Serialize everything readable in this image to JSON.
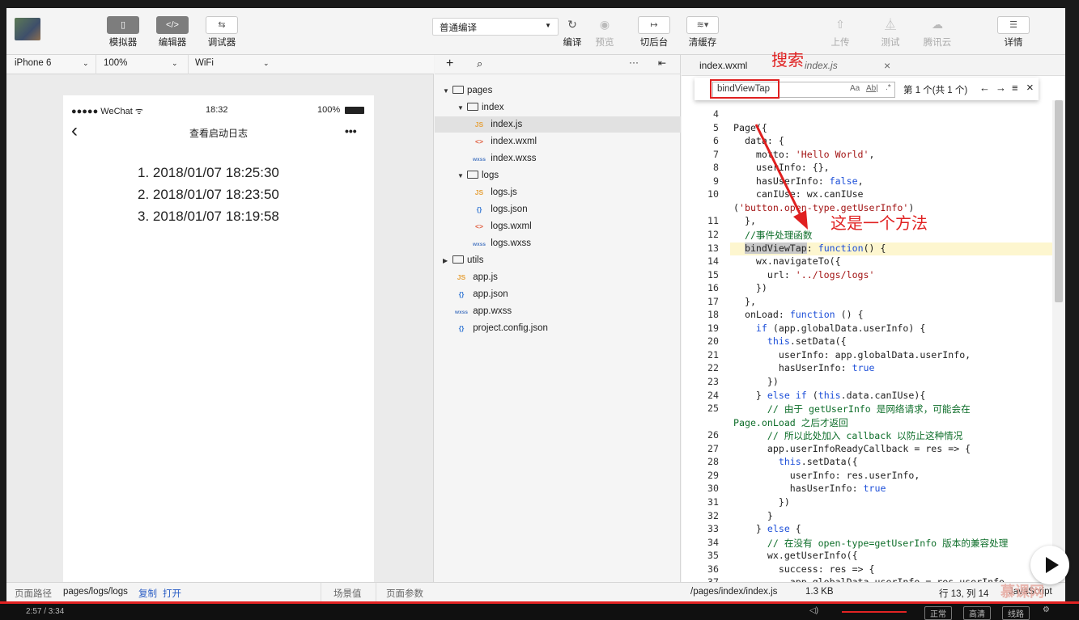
{
  "toolbar": {
    "simulator": "模拟器",
    "editor": "编辑器",
    "debugger": "调试器",
    "compile_mode": "普通编译",
    "compile": "编译",
    "preview": "预览",
    "background": "切后台",
    "clear_cache": "清缓存",
    "upload": "上传",
    "test": "测试",
    "tencent_cloud": "腾讯云",
    "details": "详情"
  },
  "simulator": {
    "device": "iPhone 6",
    "zoom": "100%",
    "network": "WiFi",
    "status_signal": "●●●●● WeChat ᯤ",
    "status_time": "18:32",
    "status_battery": "100%",
    "nav_title": "查看启动日志",
    "nav_back": "‹",
    "nav_more": "•••",
    "logs": [
      "1. 2018/01/07 18:25:30",
      "2. 2018/01/07 18:23:50",
      "3. 2018/01/07 18:19:58"
    ]
  },
  "bottom_bar": {
    "path_label": "页面路径",
    "path": "pages/logs/logs",
    "copy": "复制",
    "open": "打开",
    "scene": "场景值",
    "params": "页面参数",
    "file_path": "/pages/index/index.js",
    "file_size": "1.3 KB",
    "cursor": "行 13, 列 14",
    "language": "JavaScript"
  },
  "tree": {
    "items": [
      {
        "label": "pages",
        "type": "folder-open"
      },
      {
        "label": "index",
        "type": "folder-open"
      },
      {
        "label": "index.js",
        "type": "JS"
      },
      {
        "label": "index.wxml",
        "type": "<>"
      },
      {
        "label": "index.wxss",
        "type": "wxss"
      },
      {
        "label": "logs",
        "type": "folder-open"
      },
      {
        "label": "logs.js",
        "type": "JS"
      },
      {
        "label": "logs.json",
        "type": "{}"
      },
      {
        "label": "logs.wxml",
        "type": "<>"
      },
      {
        "label": "logs.wxss",
        "type": "wxss"
      },
      {
        "label": "utils",
        "type": "folder-closed"
      },
      {
        "label": "app.js",
        "type": "JS"
      },
      {
        "label": "app.json",
        "type": "{}"
      },
      {
        "label": "app.wxss",
        "type": "wxss"
      },
      {
        "label": "project.config.json",
        "type": "{}"
      }
    ]
  },
  "editor": {
    "tabs": [
      "index.wxml",
      "index.js"
    ],
    "search": {
      "value": "bindViewTap",
      "match_case": "Aa",
      "whole_word": "Ab|",
      "regex": ".*",
      "result": "第 1 个(共 1 个)"
    },
    "code": [
      {
        "n": "4",
        "t": ""
      },
      {
        "n": "5",
        "t": "Page({"
      },
      {
        "n": "6",
        "t": "  data: {"
      },
      {
        "n": "7",
        "t": "    motto: 'Hello World',"
      },
      {
        "n": "8",
        "t": "    userInfo: {},"
      },
      {
        "n": "9",
        "t": "    hasUserInfo: false,"
      },
      {
        "n": "10",
        "t": "    canIUse: wx.canIUse"
      },
      {
        "n": "",
        "t": "('button.open-type.getUserInfo')"
      },
      {
        "n": "11",
        "t": "  },"
      },
      {
        "n": "12",
        "t": "  //事件处理函数"
      },
      {
        "n": "13",
        "t": "  bindViewTap: function() {"
      },
      {
        "n": "14",
        "t": "    wx.navigateTo({"
      },
      {
        "n": "15",
        "t": "      url: '../logs/logs'"
      },
      {
        "n": "16",
        "t": "    })"
      },
      {
        "n": "17",
        "t": "  },"
      },
      {
        "n": "18",
        "t": "  onLoad: function () {"
      },
      {
        "n": "19",
        "t": "    if (app.globalData.userInfo) {"
      },
      {
        "n": "20",
        "t": "      this.setData({"
      },
      {
        "n": "21",
        "t": "        userInfo: app.globalData.userInfo,"
      },
      {
        "n": "22",
        "t": "        hasUserInfo: true"
      },
      {
        "n": "23",
        "t": "      })"
      },
      {
        "n": "24",
        "t": "    } else if (this.data.canIUse){"
      },
      {
        "n": "25",
        "t": "      // 由于 getUserInfo 是网络请求，可能会在"
      },
      {
        "n": "",
        "t": "Page.onLoad 之后才返回"
      },
      {
        "n": "26",
        "t": "      // 所以此处加入 callback 以防止这种情况"
      },
      {
        "n": "27",
        "t": "      app.userInfoReadyCallback = res => {"
      },
      {
        "n": "28",
        "t": "        this.setData({"
      },
      {
        "n": "29",
        "t": "          userInfo: res.userInfo,"
      },
      {
        "n": "30",
        "t": "          hasUserInfo: true"
      },
      {
        "n": "31",
        "t": "        })"
      },
      {
        "n": "32",
        "t": "      }"
      },
      {
        "n": "33",
        "t": "    } else {"
      },
      {
        "n": "34",
        "t": "      // 在没有 open-type=getUserInfo 版本的兼容处理"
      },
      {
        "n": "35",
        "t": "      wx.getUserInfo({"
      },
      {
        "n": "36",
        "t": "        success: res => {"
      },
      {
        "n": "37",
        "t": "          app.globalData.userInfo = res.userInfo"
      }
    ]
  },
  "annotations": {
    "search": "搜索",
    "method": "这是一个方法"
  },
  "player": {
    "time": "2:57 / 3:34",
    "quality": "高清",
    "speed": "正常",
    "line": "线路",
    "watermark": "慕课网"
  }
}
